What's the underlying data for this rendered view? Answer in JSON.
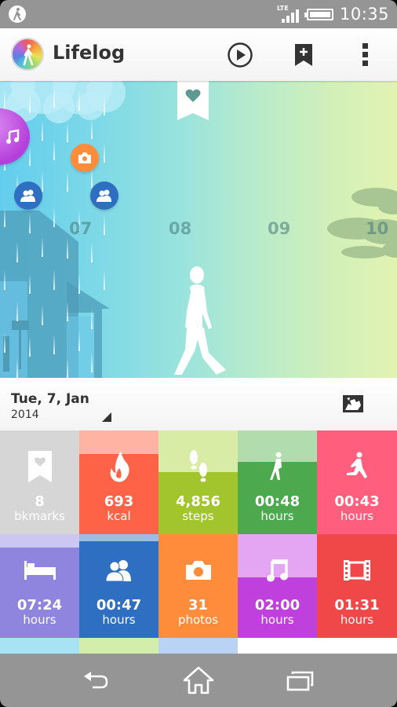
{
  "status_bar": {
    "notification_icon": "walking-person-icon",
    "network_label": "LTE",
    "signal_icon": "signal-strength-icon",
    "battery_icon": "battery-full-icon",
    "time": "10:35"
  },
  "action_bar": {
    "app_icon": "lifelog-app-icon",
    "title": "Lifelog",
    "actions": [
      {
        "name": "play",
        "icon": "play-circle-icon"
      },
      {
        "name": "add-bookmark",
        "icon": "bookmark-add-icon"
      },
      {
        "name": "more",
        "icon": "overflow-menu-icon"
      }
    ]
  },
  "timeline": {
    "hours": [
      "07",
      "08",
      "09",
      "10"
    ],
    "weather": "rain",
    "bookmark_icon": "heart-bookmark-icon",
    "bubbles": [
      {
        "type": "music",
        "icon": "music-note-icon",
        "color": "#b43fdb"
      },
      {
        "type": "camera",
        "icon": "camera-icon",
        "color": "#ff8c3a"
      },
      {
        "type": "social",
        "icon": "people-icon",
        "color": "#2f6fc2"
      },
      {
        "type": "social",
        "icon": "people-icon",
        "color": "#2f6fc2"
      }
    ],
    "activity": "walking"
  },
  "date_bar": {
    "date": "Tue, 7, Jan",
    "year": "2014",
    "map_icon": "map-globe-icon"
  },
  "tiles": [
    {
      "id": "bookmarks",
      "value": "8",
      "unit": "bkmarks",
      "icon": "bookmark-heart-icon",
      "light": "#d6d6d6",
      "dark": "#d6d6d6",
      "fill": 1.0
    },
    {
      "id": "calories",
      "value": "693",
      "unit": "kcal",
      "icon": "flame-icon",
      "light": "#ffb3a3",
      "dark": "#ff6347",
      "fill": 0.77
    },
    {
      "id": "steps",
      "value": "4,856",
      "unit": "steps",
      "icon": "footsteps-icon",
      "light": "#d9eca5",
      "dark": "#a2c52d",
      "fill": 0.6
    },
    {
      "id": "walking",
      "value": "00:48",
      "unit": "hours",
      "icon": "walking-icon",
      "light": "#b0dcae",
      "dark": "#4ca94e",
      "fill": 0.7
    },
    {
      "id": "running",
      "value": "00:43",
      "unit": "hours",
      "icon": "running-icon",
      "light": "#ff5e7d",
      "dark": "#ff5e7d",
      "fill": 1.0
    },
    {
      "id": "sleep",
      "value": "07:24",
      "unit": "hours",
      "icon": "bed-icon",
      "light": "#cbc6f2",
      "dark": "#8f84de",
      "fill": 0.87
    },
    {
      "id": "social",
      "value": "00:47",
      "unit": "hours",
      "icon": "people-icon",
      "light": "#9dbde2",
      "dark": "#2f6fc2",
      "fill": 0.93
    },
    {
      "id": "photos",
      "value": "31",
      "unit": "photos",
      "icon": "camera-icon",
      "light": "#ff8c3a",
      "dark": "#ff8c3a",
      "fill": 1.0
    },
    {
      "id": "music",
      "value": "02:00",
      "unit": "hours",
      "icon": "music-note-icon",
      "light": "#e4a6f2",
      "dark": "#c040dd",
      "fill": 0.58
    },
    {
      "id": "movies",
      "value": "01:31",
      "unit": "hours",
      "icon": "film-strip-icon",
      "light": "#f04848",
      "dark": "#f04848",
      "fill": 1.0
    }
  ],
  "tile_strips": [
    "#a8e2f5",
    "#d3edaa",
    "#b8d3f3"
  ],
  "nav_bar": {
    "buttons": [
      {
        "name": "back",
        "icon": "back-arrow-icon"
      },
      {
        "name": "home",
        "icon": "home-icon"
      },
      {
        "name": "recents",
        "icon": "recent-apps-icon"
      }
    ]
  }
}
